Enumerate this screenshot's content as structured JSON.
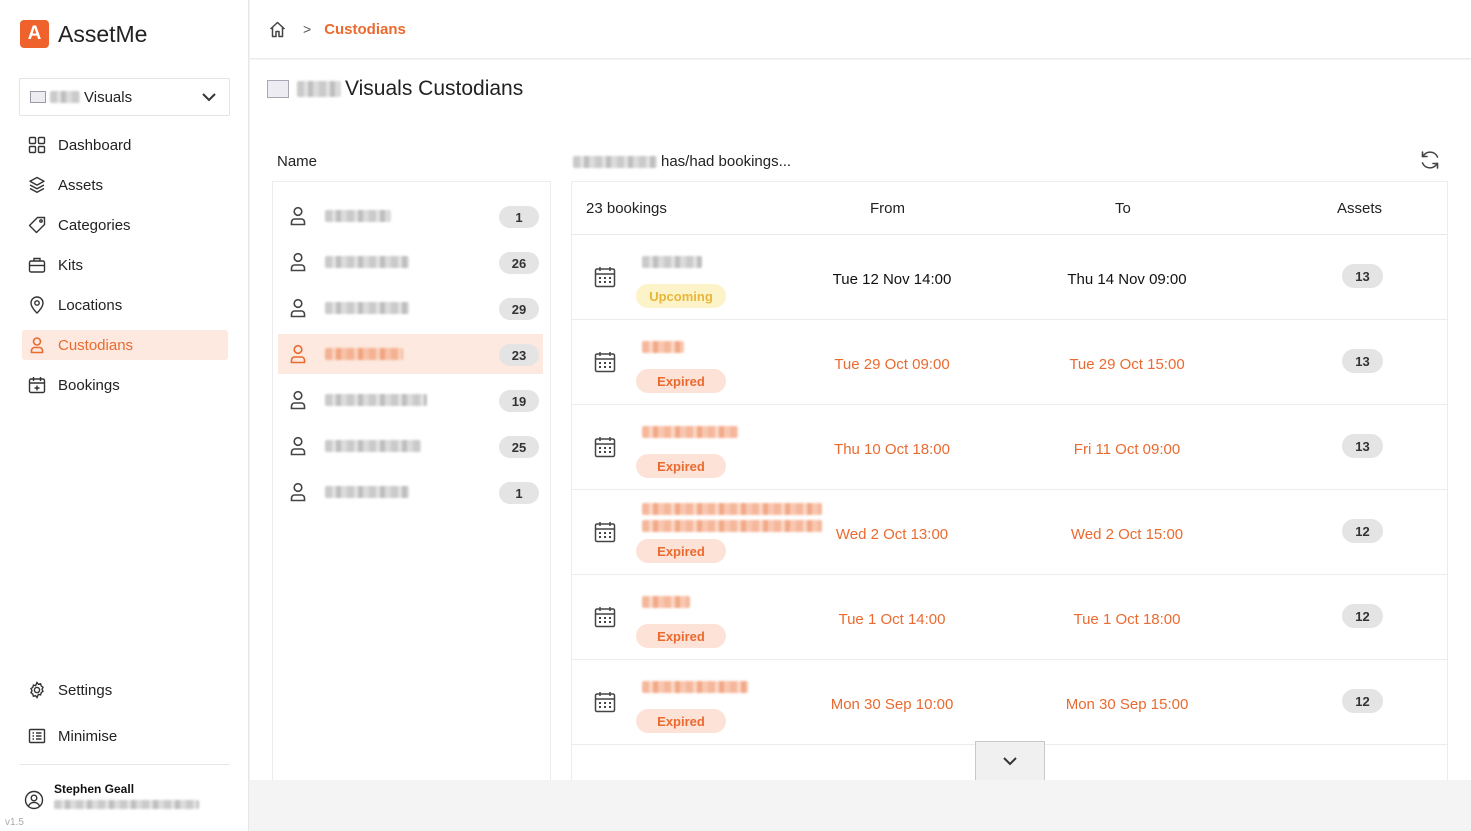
{
  "app": {
    "name": "AssetMe",
    "logo_letter": "A",
    "version": "v1.5",
    "accent": "#ea6a2f"
  },
  "workspace": {
    "name": "Visuals"
  },
  "nav": [
    {
      "label": "Dashboard",
      "icon": "dashboard-icon",
      "active": false
    },
    {
      "label": "Assets",
      "icon": "layers-icon",
      "active": false
    },
    {
      "label": "Categories",
      "icon": "tag-icon",
      "active": false
    },
    {
      "label": "Kits",
      "icon": "briefcase-icon",
      "active": false
    },
    {
      "label": "Locations",
      "icon": "location-pin-icon",
      "active": false
    },
    {
      "label": "Custodians",
      "icon": "person-icon",
      "active": true
    },
    {
      "label": "Bookings",
      "icon": "calendar-plus-icon",
      "active": false
    }
  ],
  "nav_bottom": {
    "settings": "Settings",
    "minimise": "Minimise"
  },
  "user": {
    "name": "Stephen Geall"
  },
  "breadcrumb": {
    "current": "Custodians"
  },
  "page": {
    "title": "Visuals Custodians"
  },
  "custodians": {
    "header": "Name",
    "items": [
      {
        "count": "1"
      },
      {
        "count": "26"
      },
      {
        "count": "29"
      },
      {
        "count": "23",
        "active": true
      },
      {
        "count": "19"
      },
      {
        "count": "25"
      },
      {
        "count": "1"
      }
    ]
  },
  "bookings": {
    "header_suffix": "has/had bookings...",
    "columns": {
      "count": "23 bookings",
      "from": "From",
      "to": "To",
      "assets": "Assets"
    },
    "rows": [
      {
        "status": "Upcoming",
        "from": "Tue 12 Nov 14:00",
        "to": "Thu 14 Nov 09:00",
        "assets": "13"
      },
      {
        "status": "Expired",
        "from": "Tue 29 Oct 09:00",
        "to": "Tue 29 Oct 15:00",
        "assets": "13"
      },
      {
        "status": "Expired",
        "from": "Thu 10 Oct 18:00",
        "to": "Fri 11 Oct 09:00",
        "assets": "13"
      },
      {
        "status": "Expired",
        "from": "Wed 2 Oct 13:00",
        "to": "Wed 2 Oct 15:00",
        "assets": "12"
      },
      {
        "status": "Expired",
        "from": "Tue 1 Oct 14:00",
        "to": "Tue 1 Oct 18:00",
        "assets": "12"
      },
      {
        "status": "Expired",
        "from": "Mon 30 Sep 10:00",
        "to": "Mon 30 Sep 15:00",
        "assets": "12"
      }
    ]
  }
}
